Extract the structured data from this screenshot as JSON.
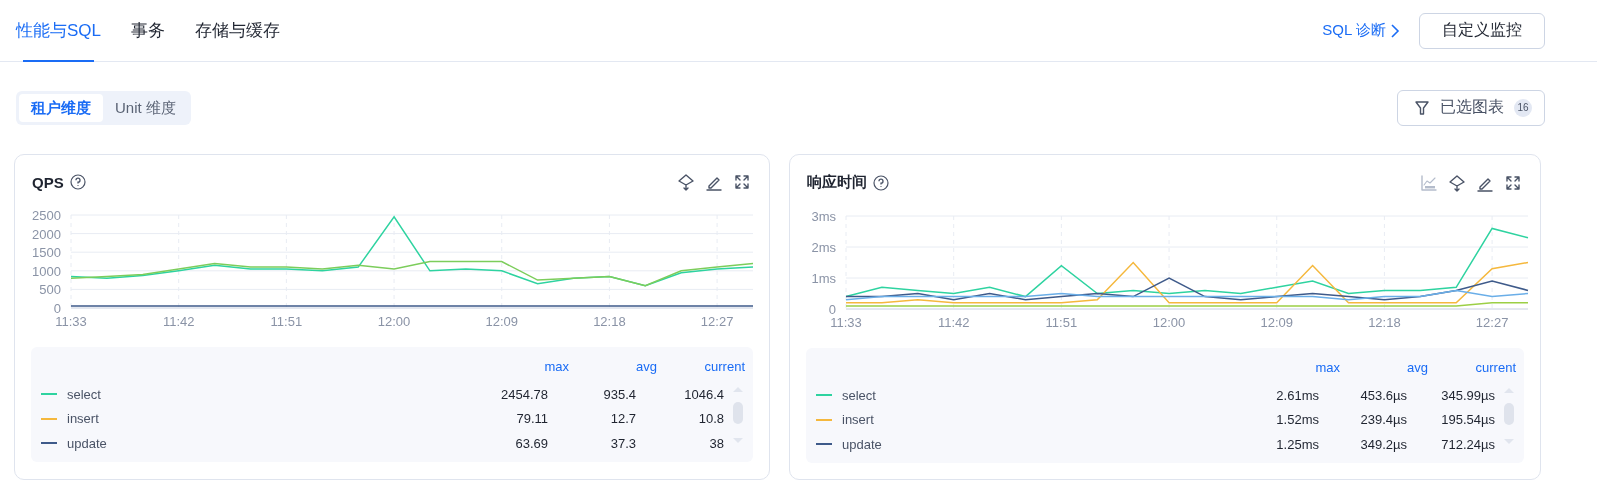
{
  "tabs": [
    {
      "label": "性能与SQL",
      "selected": true
    },
    {
      "label": "事务",
      "selected": false
    },
    {
      "label": "存储与缓存",
      "selected": false
    }
  ],
  "header_actions": {
    "link": "SQL 诊断",
    "button": "自定义监控"
  },
  "dimension_switch": [
    {
      "label": "租户维度",
      "selected": true
    },
    {
      "label": "Unit 维度",
      "selected": false
    }
  ],
  "filter_button": {
    "label": "已选图表",
    "count": "16"
  },
  "cards": [
    {
      "title": "QPS",
      "tools": [
        {
          "kind": "locate"
        },
        {
          "kind": "edit"
        },
        {
          "kind": "expand"
        }
      ],
      "chart_data": {
        "type": "line",
        "categories": [
          "11:33",
          null,
          null,
          "11:42",
          null,
          null,
          "11:51",
          null,
          null,
          "12:00",
          null,
          null,
          "12:09",
          null,
          null,
          "12:18",
          null,
          null,
          "12:27",
          null
        ],
        "grid": true,
        "ylim": [
          0,
          2500
        ],
        "yticks": [
          0,
          500,
          1000,
          1500,
          2000,
          2500
        ],
        "series": [
          {
            "color": "#2ed3a0",
            "values": [
              850,
              800,
              870,
              1000,
              1150,
              1050,
              1050,
              1000,
              1100,
              2450,
              1000,
              1050,
              1000,
              650,
              800,
              850,
              600,
              950,
              1050,
              1100
            ]
          },
          {
            "color": "#7ccd5b",
            "values": [
              800,
              850,
              900,
              1050,
              1200,
              1100,
              1100,
              1050,
              1150,
              1050,
              1250,
              1250,
              1250,
              750,
              800,
              850,
              600,
              1000,
              1100,
              1200
            ]
          },
          {
            "color": "#3e5a8a",
            "values": [
              50,
              50,
              50,
              50,
              50,
              50,
              50,
              50,
              50,
              50,
              50,
              50,
              50,
              50,
              50,
              50,
              50,
              50,
              50,
              50
            ]
          }
        ]
      },
      "legend": {
        "columns": [
          "max",
          "avg",
          "current"
        ],
        "rows": [
          {
            "name": "select",
            "color": "#2ed3a0",
            "values": [
              "2454.78",
              "935.4",
              "1046.4"
            ]
          },
          {
            "name": "insert",
            "color": "#f5b83d",
            "values": [
              "79.11",
              "12.7",
              "10.8"
            ]
          },
          {
            "name": "update",
            "color": "#3e5a8a",
            "values": [
              "63.69",
              "37.3",
              "38"
            ]
          }
        ]
      }
    },
    {
      "title": "响应时间",
      "tools": [
        {
          "kind": "sql"
        },
        {
          "kind": "locate"
        },
        {
          "kind": "edit"
        },
        {
          "kind": "expand"
        }
      ],
      "chart_data": {
        "type": "line",
        "categories": [
          "11:33",
          null,
          null,
          "11:42",
          null,
          null,
          "11:51",
          null,
          null,
          "12:00",
          null,
          null,
          "12:09",
          null,
          null,
          "12:18",
          null,
          null,
          "12:27",
          null
        ],
        "grid": true,
        "ylim": [
          0,
          3
        ],
        "yticks": [
          {
            "value": 0,
            "label": "0"
          },
          {
            "value": 1,
            "label": "1ms"
          },
          {
            "value": 2,
            "label": "2ms"
          },
          {
            "value": 3,
            "label": "3ms"
          }
        ],
        "series": [
          {
            "color": "#2ed3a0",
            "values": [
              0.4,
              0.7,
              0.6,
              0.5,
              0.7,
              0.4,
              1.4,
              0.5,
              0.6,
              0.5,
              0.6,
              0.5,
              0.7,
              0.9,
              0.5,
              0.6,
              0.6,
              0.7,
              2.6,
              2.3
            ]
          },
          {
            "color": "#f5b83d",
            "values": [
              0.2,
              0.2,
              0.3,
              0.2,
              0.2,
              0.2,
              0.2,
              0.3,
              1.5,
              0.2,
              0.2,
              0.2,
              0.2,
              1.4,
              0.2,
              0.2,
              0.2,
              0.2,
              1.3,
              1.5
            ]
          },
          {
            "color": "#3e5a8a",
            "values": [
              0.4,
              0.4,
              0.5,
              0.3,
              0.5,
              0.3,
              0.4,
              0.5,
              0.4,
              1.0,
              0.4,
              0.3,
              0.4,
              0.5,
              0.4,
              0.3,
              0.4,
              0.6,
              0.9,
              0.6
            ]
          },
          {
            "color": "#6aaee8",
            "values": [
              0.3,
              0.4,
              0.4,
              0.4,
              0.4,
              0.4,
              0.5,
              0.4,
              0.4,
              0.4,
              0.4,
              0.4,
              0.4,
              0.4,
              0.3,
              0.4,
              0.4,
              0.6,
              0.4,
              0.5
            ]
          },
          {
            "color": "#9ccf45",
            "values": [
              0.1,
              0.1,
              0.1,
              0.1,
              0.1,
              0.1,
              0.1,
              0.1,
              0.1,
              0.1,
              0.1,
              0.1,
              0.1,
              0.1,
              0.1,
              0.1,
              0.1,
              0.1,
              0.2,
              0.2
            ]
          }
        ]
      },
      "legend": {
        "columns": [
          "max",
          "avg",
          "current"
        ],
        "rows": [
          {
            "name": "select",
            "color": "#2ed3a0",
            "values": [
              "2.61ms",
              "453.6µs",
              "345.99µs"
            ]
          },
          {
            "name": "insert",
            "color": "#f5b83d",
            "values": [
              "1.52ms",
              "239.4µs",
              "195.54µs"
            ]
          },
          {
            "name": "update",
            "color": "#3e5a8a",
            "values": [
              "1.25ms",
              "349.2µs",
              "712.24µs"
            ]
          }
        ]
      }
    }
  ]
}
